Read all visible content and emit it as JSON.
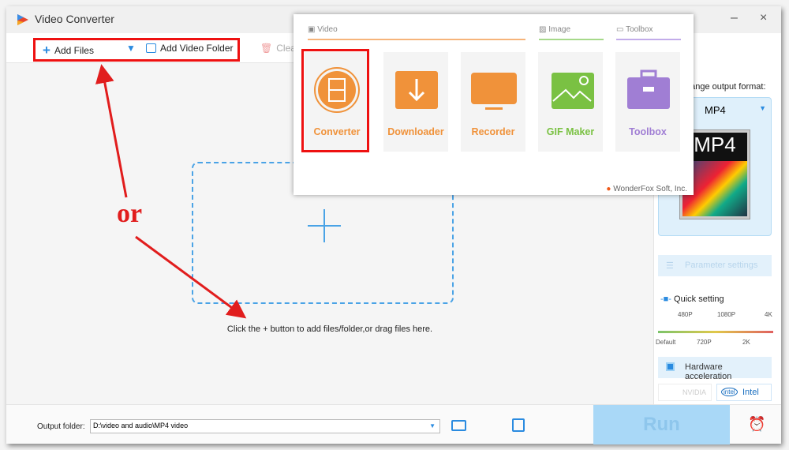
{
  "window": {
    "title": "Video Converter",
    "minimize": "–",
    "close": "×"
  },
  "toolbar": {
    "add_files": "Add Files",
    "add_video_folder": "Add Video Folder",
    "clear": "Clea"
  },
  "main": {
    "hint": "Click the + button to add files/folder,or drag files here."
  },
  "annotation": {
    "or": "or",
    "color": "#e11d1d"
  },
  "popup": {
    "sections": [
      {
        "label": "Video",
        "color": "#f0923a"
      },
      {
        "label": "Image",
        "color": "#7ac143"
      },
      {
        "label": "Toolbox",
        "color": "#a07ed4"
      }
    ],
    "apps": [
      {
        "label": "Converter",
        "color": "#f0923a"
      },
      {
        "label": "Downloader",
        "color": "#f0923a"
      },
      {
        "label": "Recorder",
        "color": "#f0923a"
      },
      {
        "label": "GIF Maker",
        "color": "#7ac143"
      },
      {
        "label": "Toolbox",
        "color": "#a07ed4"
      }
    ],
    "footer": "WonderFox Soft, Inc."
  },
  "right_panel": {
    "change_format_label": "hange output format:",
    "format": "MP4",
    "format_image_text": "MP4",
    "parameter_settings": "Parameter settings",
    "quick_setting": "Quick setting",
    "ticks_top": [
      "480P",
      "1080P",
      "4K"
    ],
    "ticks_bottom": [
      "Default",
      "720P",
      "2K"
    ],
    "hardware_acceleration": "Hardware acceleration",
    "nvidia": "NVIDIA",
    "intel": "Intel",
    "intel_logo": "intel"
  },
  "bottom": {
    "output_folder_label": "Output folder:",
    "output_folder_value": "D:\\video and audio\\MP4 video",
    "run": "Run"
  }
}
